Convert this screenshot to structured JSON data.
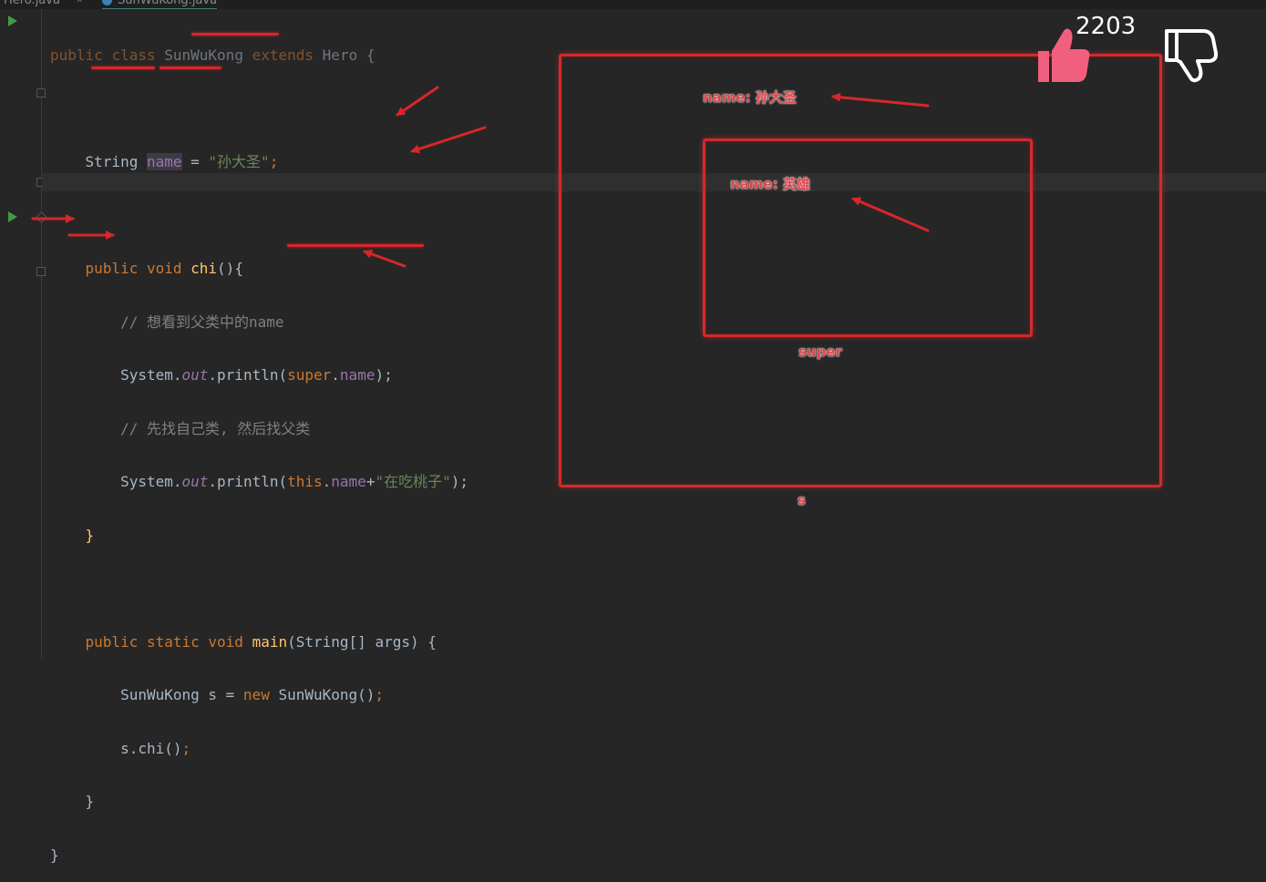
{
  "tabs": [
    {
      "label": "Hero.java",
      "close": "×"
    },
    {
      "label": "SunWuKong.java"
    }
  ],
  "code": {
    "l1": {
      "public": "public",
      "class": "class",
      "name": "SunWuKong",
      "extends": "extends",
      "parent": "Hero",
      "brace": " {"
    },
    "l3": {
      "type": "String",
      "field": "name",
      "eq": " = ",
      "value": "\"孙大圣\"",
      "semi": ";"
    },
    "l5": {
      "public": "public",
      "void": "void",
      "method": "chi",
      "rest": "(){"
    },
    "l6": {
      "comment": "// 想看到父类中的name"
    },
    "l7": {
      "sys": "System.",
      "out": "out",
      "println": ".println(",
      "super": "super",
      "dot": ".",
      "field": "name",
      "end": ");"
    },
    "l8": {
      "comment": "// 先找自己类, 然后找父类"
    },
    "l9": {
      "sys": "System.",
      "out": "out",
      "println": ".println(",
      "this": "this",
      "dot": ".",
      "field": "name",
      "plus": "+",
      "str": "\"在吃桃子\"",
      "end": ");"
    },
    "l10": {
      "brace": "}"
    },
    "l12": {
      "public": "public",
      "static": "static",
      "void": "void",
      "method": "main",
      "rest": "(String[] args) {"
    },
    "l13": {
      "decl": "SunWuKong s = ",
      "new": "new",
      "ctor": " SunWuKong()",
      "semi": ";"
    },
    "l14": {
      "call": "s.chi()",
      "semi": ";"
    },
    "l15": {
      "brace": "}"
    },
    "l16": {
      "brace": "}"
    }
  },
  "diagram": {
    "outer_label": "s",
    "inner_label": "super",
    "outer_field": "name: 孙大圣",
    "inner_field": "name: 英雄",
    "accent": "#d42a2c"
  },
  "reactions": {
    "like_count": "2203",
    "like_icon": "thumbs-up-icon",
    "dislike_icon": "thumbs-down-icon",
    "like_color": "#f0607e"
  }
}
